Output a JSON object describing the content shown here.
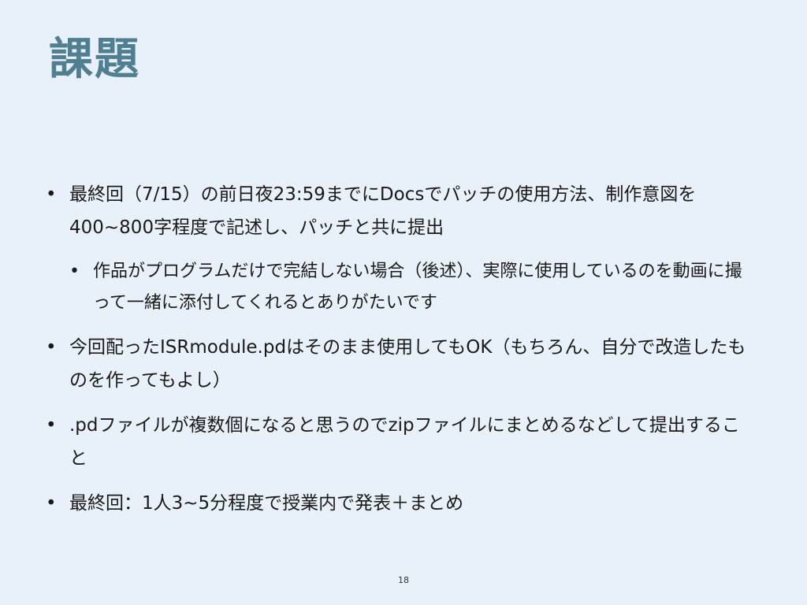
{
  "slide": {
    "title": "課題",
    "bullets": [
      {
        "level": 1,
        "text": "最終回（7/15）の前日夜23:59までにDocsでパッチの使用方法、制作意図を400~800字程度で記述し、パッチと共に提出"
      },
      {
        "level": 2,
        "text": "作品がプログラムだけで完結しない場合（後述）、実際に使用しているのを動画に撮って一緒に添付してくれるとありがたいです"
      },
      {
        "level": 1,
        "text": "今回配ったISRmodule.pdはそのまま使用してもOK（もちろん、自分で改造したものを作ってもよし）"
      },
      {
        "level": 1,
        "text": ".pdファイルが複数個になると思うのでzipファイルにまとめるなどして提出すること"
      },
      {
        "level": 1,
        "text": "最終回：1人3~5分程度で授業内で発表＋まとめ"
      }
    ],
    "page_number": "18"
  }
}
